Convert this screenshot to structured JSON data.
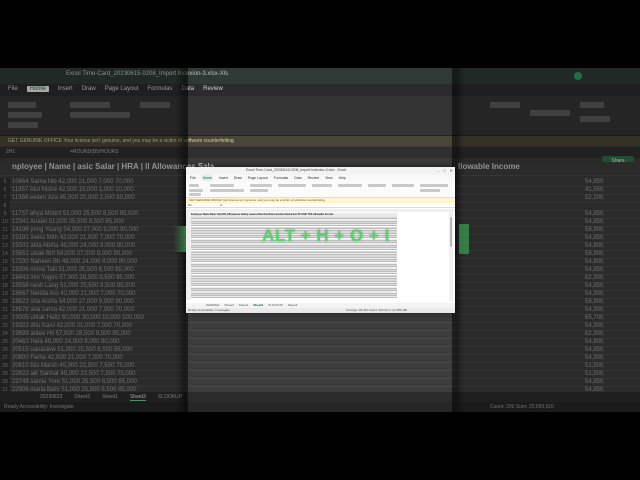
{
  "background": {
    "title": "Excel Time-Card_20230615-0208_Import Indexion-3.xlsx-Xls",
    "menu": [
      "File",
      "Home",
      "Insert",
      "Draw",
      "Page Layout",
      "Formulas",
      "Data",
      "Review"
    ],
    "active_menu": "Home",
    "message": "GET GENUINE OFFICE   Your license isn't genuine, and you may be a victim of software counterfeiting",
    "cell_ref": "2H1",
    "formula": "=ROUND(B5/HOURS",
    "share_label": "Share",
    "left_headers": "nployee | Name | asic Salar | HRA | ll Allowances Sala",
    "right_header": "llowable Income",
    "col_letters": [
      "T",
      "U"
    ],
    "rows": [
      {
        "num": "5",
        "left": "10664  Sama Nib  42,000   21,000   7,000   70,000",
        "right": "54,850"
      },
      {
        "num": "6",
        "left": "11357  Atul Nishe  42,500   15,000   1,000   10,000",
        "right": "41,550"
      },
      {
        "num": "7",
        "left": "11384  eelam Aza  45,000   20,000   2,500   80,500",
        "right": "52,200"
      },
      {
        "num": "8",
        "left": "",
        "right": ""
      },
      {
        "num": "9",
        "left": "11757  ahya Moorit  51,000   25,500   8,500   85,000",
        "right": "54,850"
      },
      {
        "num": "10",
        "left": "12341  Anaiet  51,000   25,500   8,500   85,000",
        "right": "54,850"
      },
      {
        "num": "11",
        "left": "14196  yong Young  54,000   27,000   9,000   90,000",
        "right": "58,900"
      },
      {
        "num": "12",
        "left": "15191  inwisi Mith  42,000   21,000   7,000   70,000",
        "right": "54,850"
      },
      {
        "num": "13",
        "left": "15501  akta Abiha  48,000   24,000   8,000   80,000",
        "right": "54,800"
      },
      {
        "num": "14",
        "left": "15651  ulvak Birt  54,000   27,000   9,000   90,000",
        "right": "58,900"
      },
      {
        "num": "15",
        "left": "17330  Naheen Bh  48,000   24,000   8,000   80,000",
        "right": "54,800"
      },
      {
        "num": "16",
        "left": "18336  mima Taili  51,000   25,500   8,500   85,000",
        "right": "54,850"
      },
      {
        "num": "17",
        "left": "18443  inni Yoges  57,000   28,500   9,500   95,000",
        "right": "62,300"
      },
      {
        "num": "18",
        "left": "18558  nesh Lang  51,000   25,500   8,500   85,000",
        "right": "54,850"
      },
      {
        "num": "19",
        "left": "18667  Nerida Aro  42,000   21,000   7,000   70,000",
        "right": "54,300"
      },
      {
        "num": "20",
        "left": "18822  sha Arsha  54,000   27,000   9,000   90,000",
        "right": "58,900"
      },
      {
        "num": "21",
        "left": "18878  ana zahra  42,000   21,000   7,000   70,000",
        "right": "54,300"
      },
      {
        "num": "22",
        "left": "19005  uhtak Hafiz  60,000   30,000   10,000  100,000",
        "right": "65,700"
      },
      {
        "num": "23",
        "left": "19322  dhu Kaivi  42,000   21,000   7,000   70,000",
        "right": "54,300"
      },
      {
        "num": "24",
        "left": "19699  antee Hil  57,000   28,500   9,500   95,000",
        "right": "62,300"
      },
      {
        "num": "25",
        "left": "20463  Hala  48,000   24,000   8,000   80,000",
        "right": "54,800"
      },
      {
        "num": "26",
        "left": "20515  uanasiew  51,000   25,500   8,500   85,000",
        "right": "54,850"
      },
      {
        "num": "27",
        "left": "20800  Farhe  42,000   21,000   7,000   70,000",
        "right": "54,300"
      },
      {
        "num": "28",
        "left": "20810  bisi Marsh  45,000   22,500   7,500   75,000",
        "right": "51,500"
      },
      {
        "num": "29",
        "left": "22622  aik Sanhat  45,000   22,500   7,500   75,000",
        "right": "51,500"
      },
      {
        "num": "30",
        "left": "22748  samia Yore  51,000   25,500   8,500   85,000",
        "right": "54,850"
      },
      {
        "num": "31",
        "left": "22906  maria Bahr  51,000   25,500   8,500   85,000",
        "right": "54,850"
      },
      {
        "num": "32",
        "left": "23070  uiza Geora  48,000   24,000   8,000   80,000",
        "right": "54,800"
      }
    ],
    "sheet_tabs": [
      "20230623",
      "Sheet2",
      "Sheet1",
      "Sheet3",
      "XLOOKUP"
    ],
    "active_sheet_tab": "Sheet3",
    "status_left": "Ready   Accessibility: Investigate",
    "status_right": "Count: 200   Sum: 20,559,916"
  },
  "window": {
    "title": "Excel Time-Card_20230615-0208_Import Indexion-3.xlsx - Excel",
    "menu": [
      "File",
      "Home",
      "Insert",
      "Draw",
      "Page Layout",
      "Formulas",
      "Data",
      "Review",
      "View",
      "Help"
    ],
    "active_menu": "Home",
    "message": "GET GENUINE OFFICE   Your license isn't genuine, and you may be a victim of software counterfeiting.",
    "cell_ref": "D1",
    "formula": "fx",
    "header_row": "Employee  Name  Basic Sal  HRA  Allowances  Salary  Leaves  Rate  Overtime  Incentive  Deduction  PF  ESIC  TDS  Allowable  Income",
    "sheet_tabs": [
      "20230623",
      "Sheet2",
      "Sheet1",
      "Sheet3",
      "XLOOKUP",
      "Sheet4"
    ],
    "active_sheet_tab": "Sheet3",
    "status_left": "Ready  Accessibility: Investigate",
    "status_right": "Average: 38,404   Count: 320   Sum: 12,289,280"
  },
  "overlay": {
    "shortcut_text": "ALT + H + O + I"
  },
  "colors": {
    "accent_green": "#57d36b",
    "excel_green": "#0f6b37"
  }
}
